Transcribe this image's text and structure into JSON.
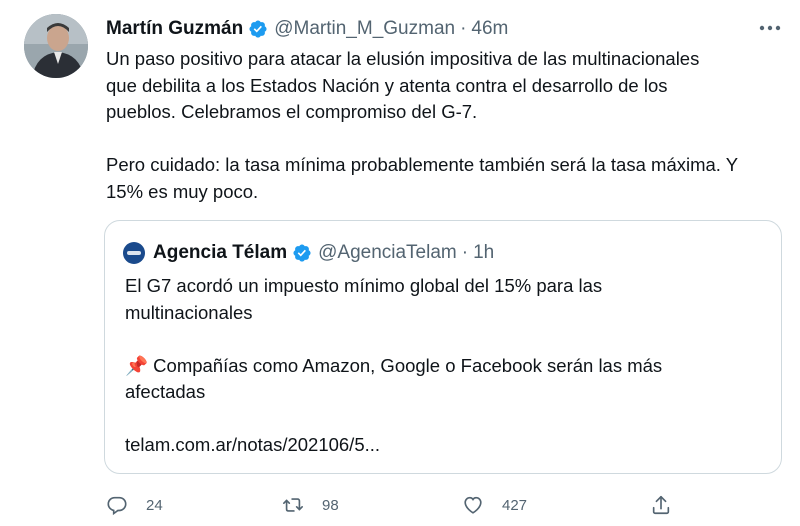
{
  "tweet": {
    "author_name": "Martín Guzmán",
    "author_handle": "@Martin_M_Guzman",
    "separator": "·",
    "time": "46m",
    "text_lines": [
      "Un paso positivo para atacar la elusión impositiva de las multinacionales",
      "que debilita a los Estados Nación y atenta contra el desarrollo de los",
      "pueblos. Celebramos el compromiso del G-7.",
      "Pero cuidado: la tasa mínima probablemente también será la tasa máxima. Y",
      "15% es muy poco."
    ]
  },
  "quote": {
    "author_name": "Agencia Télam",
    "author_handle": "@AgenciaTelam",
    "separator": "·",
    "time": "1h",
    "text_lines": [
      "El G7 acordó un impuesto mínimo global del 15% para las",
      "multinacionales",
      "📌 Compañías como Amazon, Google o Facebook serán las más",
      "afectadas",
      "telam.com.ar/notas/202106/5..."
    ]
  },
  "actions": {
    "reply_count": "24",
    "retweet_count": "98",
    "like_count": "427"
  },
  "colors": {
    "verified": "#1d9bf0",
    "secondary_text": "#536471",
    "border": "#cfd9de"
  },
  "icons": [
    "verified-badge-icon",
    "more-icon",
    "reply-icon",
    "retweet-icon",
    "like-icon",
    "share-icon"
  ]
}
